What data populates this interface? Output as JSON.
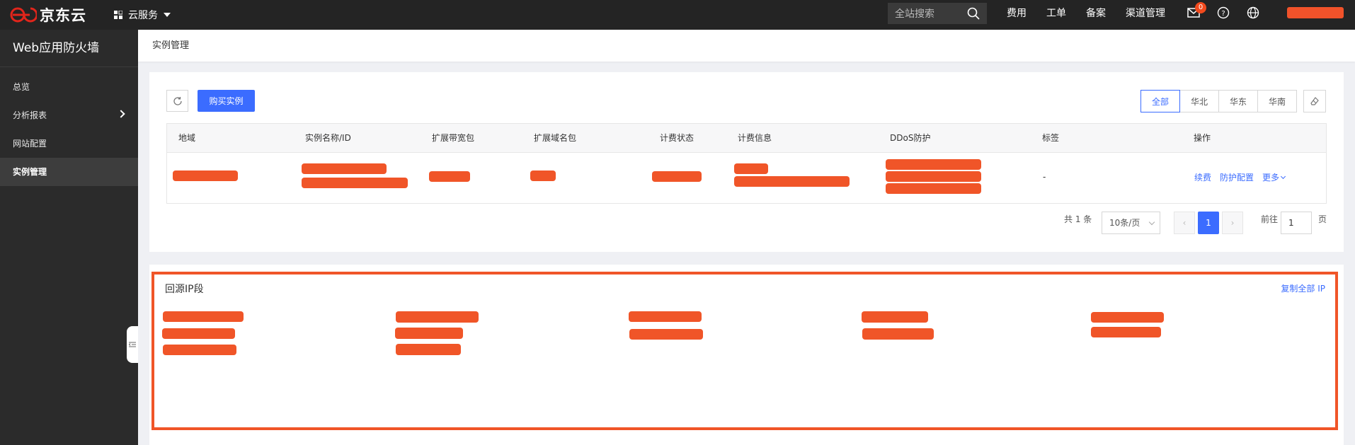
{
  "topbar": {
    "brand": "京东云",
    "service_menu": "云服务",
    "search_placeholder": "全站搜索",
    "nav": [
      "费用",
      "工单",
      "备案",
      "渠道管理"
    ],
    "mail_badge": "0",
    "accent": "#f05528"
  },
  "sidebar": {
    "title": "Web应用防火墙",
    "items": [
      {
        "label": "总览"
      },
      {
        "label": "分析报表"
      },
      {
        "label": "网站配置"
      },
      {
        "label": "实例管理"
      }
    ]
  },
  "breadcrumb": "实例管理",
  "toolbar": {
    "buy_label": "购买实例",
    "regions": [
      "全部",
      "华北",
      "华东",
      "华南"
    ]
  },
  "table": {
    "headers": [
      "地域",
      "实例名称/ID",
      "扩展带宽包",
      "扩展域名包",
      "计费状态",
      "计费信息",
      "DDoS防护",
      "标签",
      "操作"
    ],
    "row": {
      "tag": "-",
      "ops": [
        "续费",
        "防护配置",
        "更多"
      ]
    }
  },
  "pagination": {
    "total": "共 1 条",
    "page_size": "10条/页",
    "current_page": "1",
    "goto_label": "前往",
    "goto_value": "1",
    "page_suffix": "页"
  },
  "ip_section": {
    "title": "回源IP段",
    "copy_all": "复制全部 IP"
  }
}
